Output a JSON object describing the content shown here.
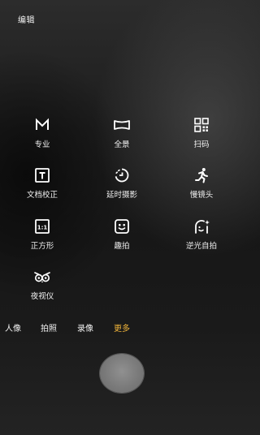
{
  "header": {
    "edit_label": "编辑"
  },
  "modes": [
    {
      "label": "专业",
      "icon": "pro-mode-icon"
    },
    {
      "label": "全景",
      "icon": "panorama-icon"
    },
    {
      "label": "扫码",
      "icon": "qr-scan-icon"
    },
    {
      "label": "文档校正",
      "icon": "document-correction-icon"
    },
    {
      "label": "延时摄影",
      "icon": "timelapse-icon"
    },
    {
      "label": "慢镜头",
      "icon": "slow-motion-icon"
    },
    {
      "label": "正方形",
      "icon": "square-mode-icon",
      "icon_text": "1:1"
    },
    {
      "label": "趣拍",
      "icon": "fun-shot-icon"
    },
    {
      "label": "逆光自拍",
      "icon": "backlight-selfie-icon"
    },
    {
      "label": "夜视仪",
      "icon": "night-vision-icon"
    }
  ],
  "tabs": [
    {
      "label": "人像",
      "active": false
    },
    {
      "label": "拍照",
      "active": false
    },
    {
      "label": "录像",
      "active": false
    },
    {
      "label": "更多",
      "active": true
    }
  ],
  "colors": {
    "accent": "#f0b43a",
    "text": "#ffffff"
  }
}
